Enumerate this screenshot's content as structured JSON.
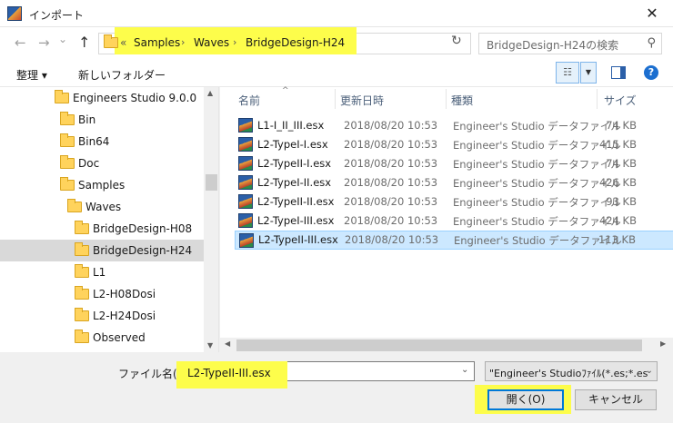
{
  "window": {
    "title": "インポート",
    "close": "✕"
  },
  "nav": {
    "back": "←",
    "forward": "→",
    "dropdown": "⌄",
    "up": "↑",
    "overflow": "«",
    "breadcrumbs": [
      "Samples",
      "Waves",
      "BridgeDesign-H24"
    ],
    "sep": "›",
    "refresh": "↻",
    "search_placeholder": "BridgeDesign-H24の検索",
    "search_icon": "⚲"
  },
  "toolbar": {
    "organize": "整理 ▾",
    "new_folder": "新しいフォルダー",
    "help": "?"
  },
  "tree": [
    {
      "label": "Engineers Studio 9.0.0",
      "indent": 1
    },
    {
      "label": "Bin",
      "indent": 2
    },
    {
      "label": "Bin64",
      "indent": 2
    },
    {
      "label": "Doc",
      "indent": 2
    },
    {
      "label": "Samples",
      "indent": 2
    },
    {
      "label": "Waves",
      "indent": 3
    },
    {
      "label": "BridgeDesign-H08",
      "indent": 4
    },
    {
      "label": "BridgeDesign-H24",
      "indent": 4,
      "selected": true
    },
    {
      "label": "L1",
      "indent": 4
    },
    {
      "label": "L2-H08Dosi",
      "indent": 4
    },
    {
      "label": "L2-H24Dosi",
      "indent": 4
    },
    {
      "label": "Observed",
      "indent": 4
    }
  ],
  "columns": {
    "name": "名前",
    "date": "更新日時",
    "type": "種類",
    "size": "サイズ",
    "sort": "^"
  },
  "files": [
    {
      "name": "L1-I_II_III.esx",
      "date": "2018/08/20 10:53",
      "type": "Engineer's Studio データファイル",
      "size": "74 KB"
    },
    {
      "name": "L2-TypeI-I.esx",
      "date": "2018/08/20 10:53",
      "type": "Engineer's Studio データファイル",
      "size": "415 KB"
    },
    {
      "name": "L2-TypeII-I.esx",
      "date": "2018/08/20 10:53",
      "type": "Engineer's Studio データファイル",
      "size": "74 KB"
    },
    {
      "name": "L2-TypeI-II.esx",
      "date": "2018/08/20 10:53",
      "type": "Engineer's Studio データファイル",
      "size": "426 KB"
    },
    {
      "name": "L2-TypeII-II.esx",
      "date": "2018/08/20 10:53",
      "type": "Engineer's Studio データファイル",
      "size": "93 KB"
    },
    {
      "name": "L2-TypeI-III.esx",
      "date": "2018/08/20 10:53",
      "type": "Engineer's Studio データファイル",
      "size": "424 KB"
    },
    {
      "name": "L2-TypeII-III.esx",
      "date": "2018/08/20 10:53",
      "type": "Engineer's Studio データファイル",
      "size": "113 KB",
      "selected": true
    }
  ],
  "footer": {
    "filename_label": "ファイル名(N):",
    "filename_value": "L2-TypeII-III.esx",
    "filetype": "\"Engineer's Studioﾌｧｲﾙ(*.es;*.es",
    "open": "開く(O)",
    "cancel": "キャンセル",
    "dropdown": "⌄"
  },
  "colors": {
    "highlight": "#fdfd4b",
    "selection": "#cce8ff",
    "accent": "#0078d7"
  }
}
